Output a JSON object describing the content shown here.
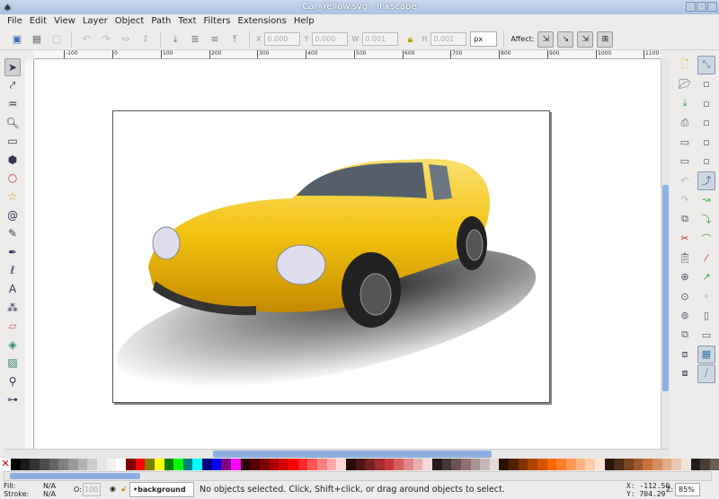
{
  "window": {
    "title": "Car_Yellow.svg - Inkscape",
    "min": "_",
    "max": "□",
    "close": "x"
  },
  "menu": [
    "File",
    "Edit",
    "View",
    "Layer",
    "Object",
    "Path",
    "Text",
    "Filters",
    "Extensions",
    "Help"
  ],
  "toolbar": {
    "x_label": "X",
    "x_value": "0.000",
    "y_label": "Y",
    "y_value": "0.000",
    "w_label": "W",
    "w_value": "0.001",
    "h_label": "H",
    "h_value": "0.001",
    "unit": "px",
    "affect_label": "Affect:"
  },
  "ruler": {
    "h_labels": [
      "-100",
      "0",
      "100",
      "200",
      "300",
      "400",
      "500",
      "600",
      "700",
      "800",
      "900",
      "1000",
      "1100"
    ]
  },
  "status": {
    "fill_label": "Fill:",
    "fill_value": "N/A",
    "stroke_label": "Stroke:",
    "stroke_value": "N/A",
    "opacity_label": "O:",
    "opacity_value": "100",
    "layer": "•background",
    "message": "No objects selected. Click, Shift+click, or drag around objects to select.",
    "x_coord": "X: -112.50",
    "y_coord": "Y:  704.29",
    "zoom_label": "Z:",
    "zoom_value": "85%"
  },
  "palette": [
    "#000000",
    "#1a1a1a",
    "#333333",
    "#4d4d4d",
    "#666666",
    "#808080",
    "#999999",
    "#b3b3b3",
    "#cccccc",
    "#e6e6e6",
    "#f2f2f2",
    "#ffffff",
    "#800000",
    "#ff0000",
    "#808000",
    "#ffff00",
    "#008000",
    "#00ff00",
    "#008080",
    "#00ffff",
    "#000080",
    "#0000ff",
    "#800080",
    "#ff00ff",
    "#2b0000",
    "#550000",
    "#800000",
    "#aa0000",
    "#d40000",
    "#ff0000",
    "#ff2a2a",
    "#ff5555",
    "#ff8080",
    "#ffaaaa",
    "#ffd5d5",
    "#280b0b",
    "#501616",
    "#782121",
    "#a02c2c",
    "#c83737",
    "#d35f5f",
    "#de8787",
    "#e9afaf",
    "#f4d7d7",
    "#241c1c",
    "#483737",
    "#6c5353",
    "#916f6f",
    "#ac9393",
    "#c8b7b7",
    "#e3dbdb",
    "#2b1100",
    "#552200",
    "#803300",
    "#aa4400",
    "#d45500",
    "#ff6600",
    "#ff7f2a",
    "#ff9955",
    "#ffb380",
    "#ffccaa",
    "#ffe6d5",
    "#28170b",
    "#502d16",
    "#784421",
    "#a05a2c",
    "#c87137",
    "#d38d5f",
    "#deaa87",
    "#e9c6af",
    "#f4e3d7",
    "#241f1c",
    "#483e37",
    "#6c5d53"
  ]
}
